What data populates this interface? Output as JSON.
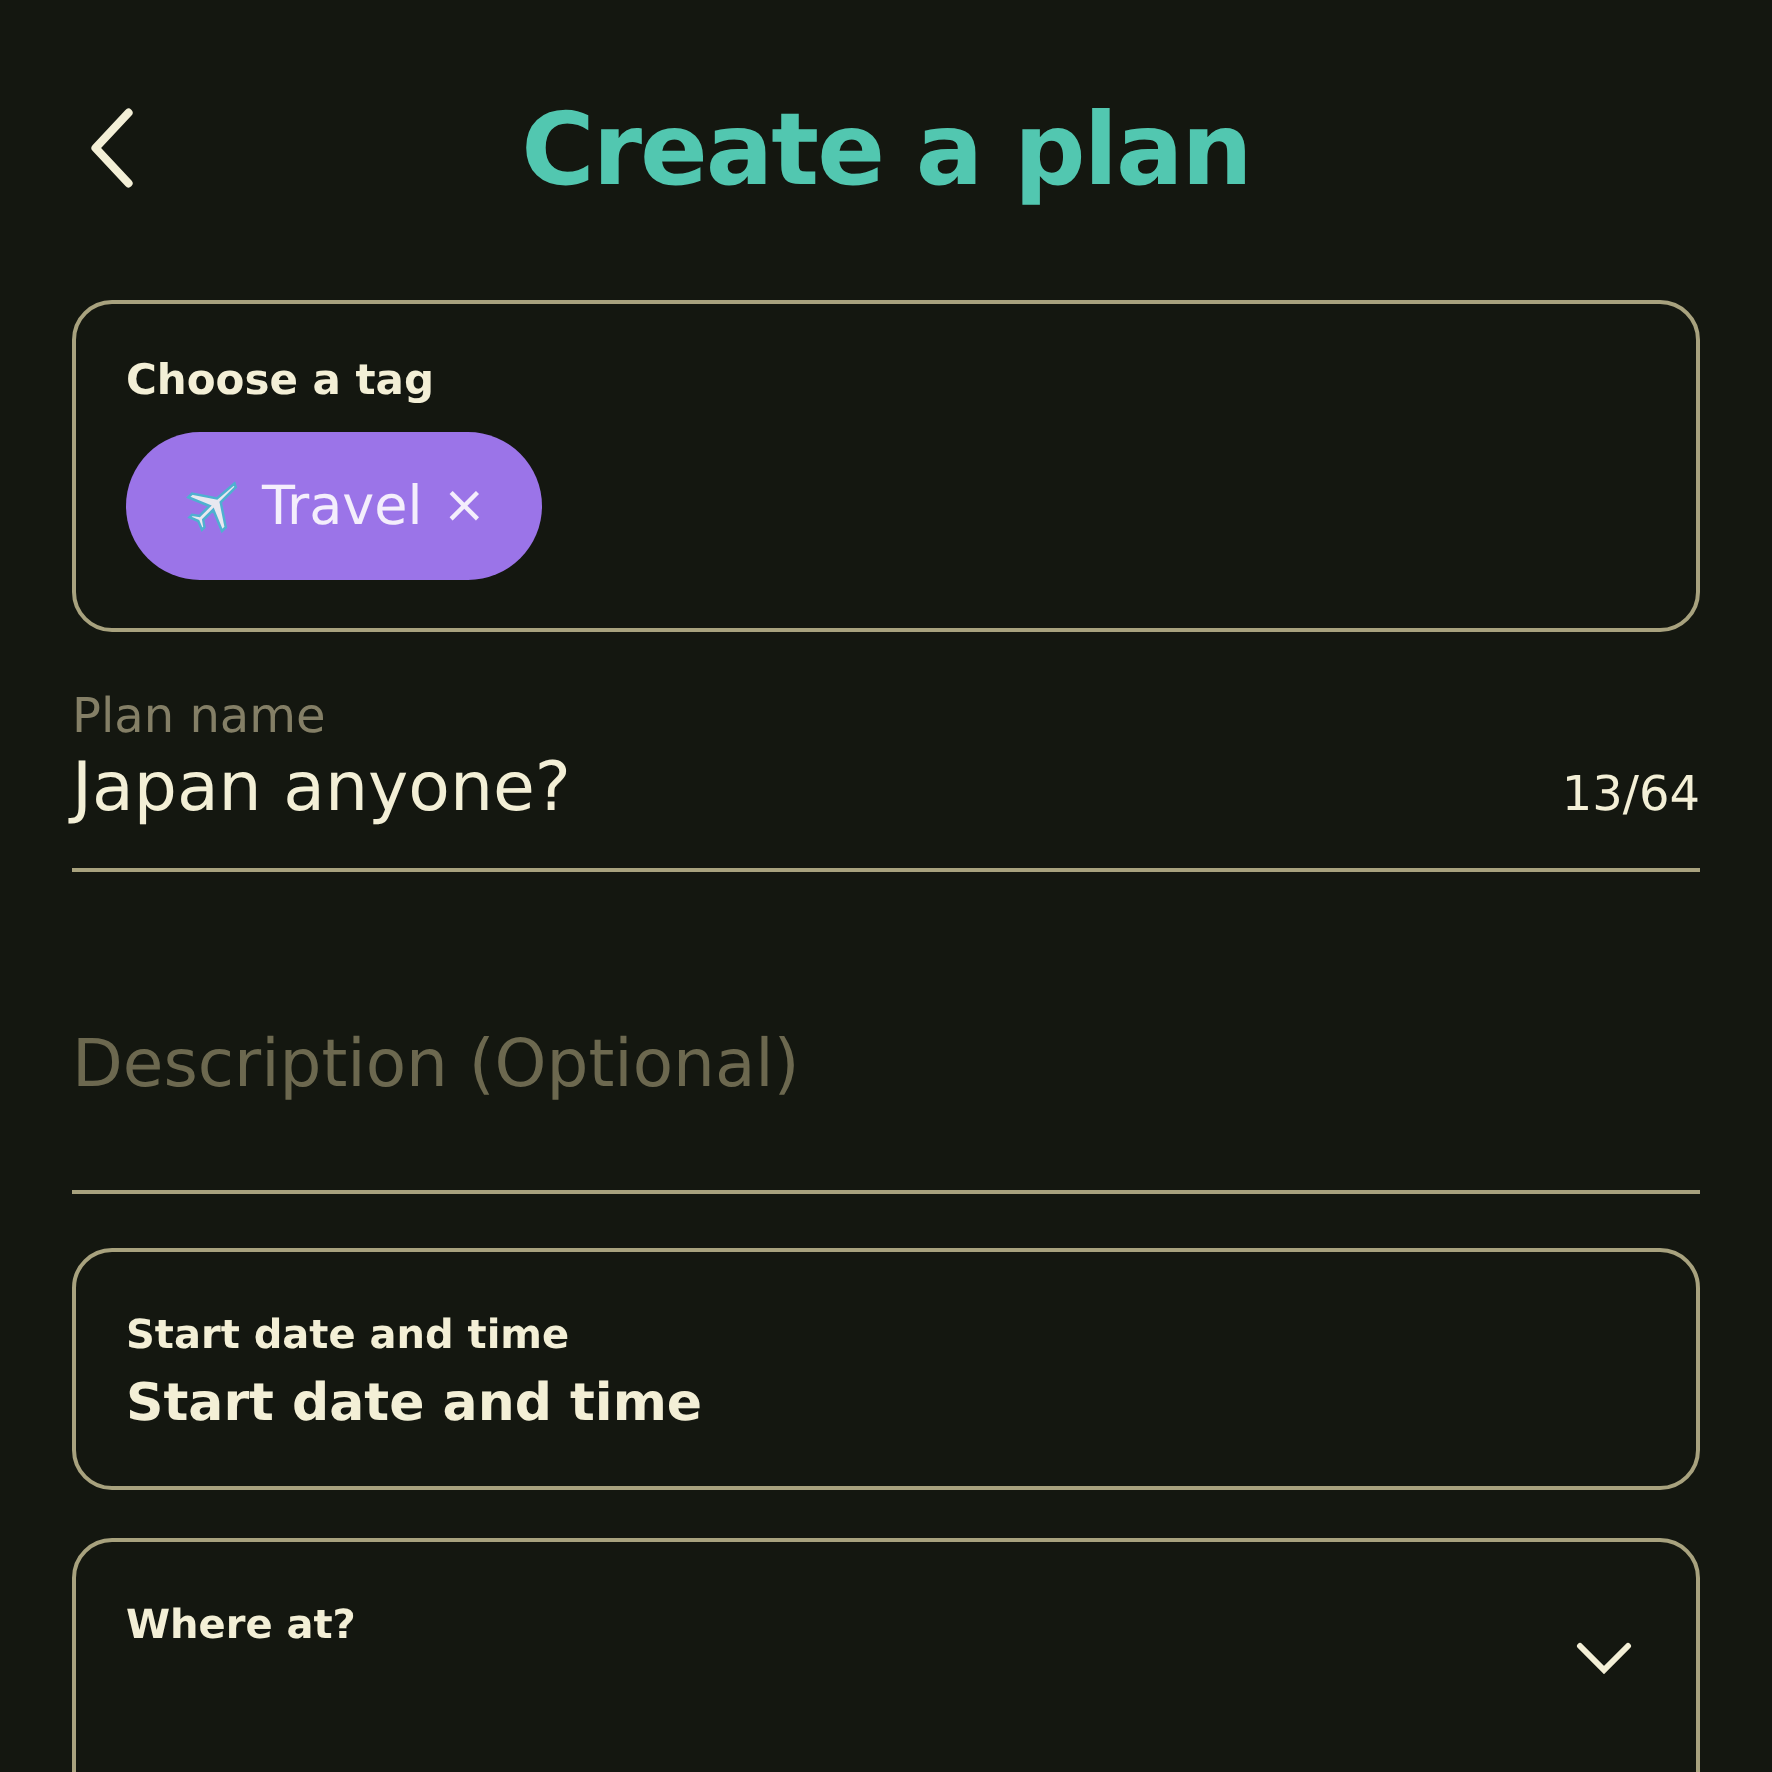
{
  "header": {
    "title": "Create a plan"
  },
  "tag_picker": {
    "label": "Choose a tag",
    "tags": [
      {
        "label": "Travel",
        "remove": "×"
      }
    ]
  },
  "plan_name": {
    "label": "Plan name",
    "value": "Japan anyone?",
    "counter": "13/64"
  },
  "description": {
    "placeholder": "Description (Optional)"
  },
  "start": {
    "label": "Start date and time",
    "value": "Start date and time"
  },
  "location": {
    "label": "Where at?"
  }
}
